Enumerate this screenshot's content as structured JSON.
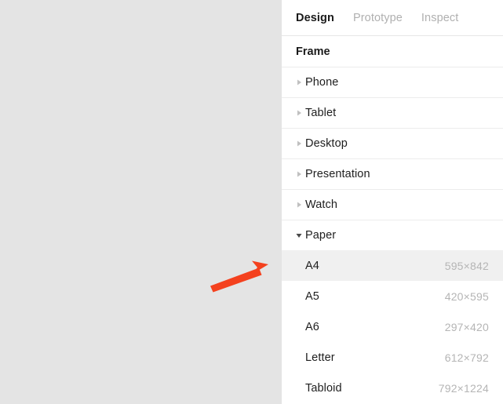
{
  "canvas": {
    "background_color": "#E4E4E4"
  },
  "annotation": {
    "arrow_color": "#F4411E",
    "name": "red-arrow-pointing-to-a4"
  },
  "panel": {
    "background_color": "#FFFFFF",
    "tabs": [
      {
        "label": "Design",
        "active": true
      },
      {
        "label": "Prototype",
        "active": false
      },
      {
        "label": "Inspect",
        "active": false
      }
    ],
    "section_title": "Frame",
    "groups": [
      {
        "label": "Phone",
        "expanded": false
      },
      {
        "label": "Tablet",
        "expanded": false
      },
      {
        "label": "Desktop",
        "expanded": false
      },
      {
        "label": "Presentation",
        "expanded": false
      },
      {
        "label": "Watch",
        "expanded": false
      },
      {
        "label": "Paper",
        "expanded": true
      }
    ],
    "paper_sizes": [
      {
        "name": "A4",
        "dimensions": "595×842",
        "selected": true
      },
      {
        "name": "A5",
        "dimensions": "420×595",
        "selected": false
      },
      {
        "name": "A6",
        "dimensions": "297×420",
        "selected": false
      },
      {
        "name": "Letter",
        "dimensions": "612×792",
        "selected": false
      },
      {
        "name": "Tabloid",
        "dimensions": "792×1224",
        "selected": false
      }
    ]
  }
}
